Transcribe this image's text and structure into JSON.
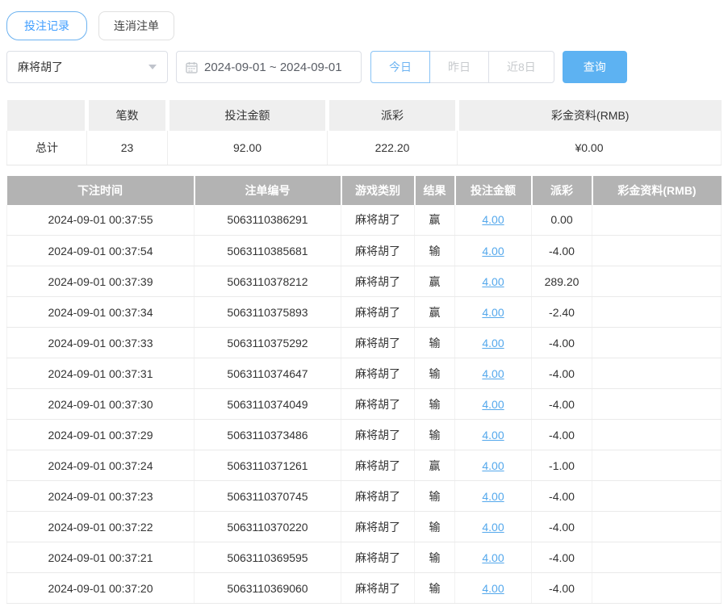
{
  "tabs": [
    {
      "label": "投注记录",
      "active": true
    },
    {
      "label": "连消注单",
      "active": false
    }
  ],
  "filters": {
    "game_selected": "麻将胡了",
    "date_range": "2024-09-01 ~ 2024-09-01",
    "quick_buttons": [
      "今日",
      "昨日",
      "近8日"
    ],
    "active_quick_button": "今日",
    "search_label": "查询"
  },
  "summary": {
    "headers": [
      "",
      "笔数",
      "投注金额",
      "派彩",
      "彩金资料(RMB)"
    ],
    "total": {
      "label": "总计",
      "count": "23",
      "bet": "92.00",
      "payout": "222.20",
      "bonus": "¥0.00"
    }
  },
  "table": {
    "headers": [
      "下注时间",
      "注单编号",
      "游戏类别",
      "结果",
      "投注金额",
      "派彩",
      "彩金资料(RMB)"
    ],
    "rows": [
      {
        "time": "2024-09-01 00:37:55",
        "order_no": "5063110386291",
        "game": "麻将胡了",
        "result": "赢",
        "bet": "4.00",
        "payout": "0.00",
        "bonus": ""
      },
      {
        "time": "2024-09-01 00:37:54",
        "order_no": "5063110385681",
        "game": "麻将胡了",
        "result": "输",
        "bet": "4.00",
        "payout": "-4.00",
        "bonus": ""
      },
      {
        "time": "2024-09-01 00:37:39",
        "order_no": "5063110378212",
        "game": "麻将胡了",
        "result": "赢",
        "bet": "4.00",
        "payout": "289.20",
        "bonus": ""
      },
      {
        "time": "2024-09-01 00:37:34",
        "order_no": "5063110375893",
        "game": "麻将胡了",
        "result": "赢",
        "bet": "4.00",
        "payout": "-2.40",
        "bonus": ""
      },
      {
        "time": "2024-09-01 00:37:33",
        "order_no": "5063110375292",
        "game": "麻将胡了",
        "result": "输",
        "bet": "4.00",
        "payout": "-4.00",
        "bonus": ""
      },
      {
        "time": "2024-09-01 00:37:31",
        "order_no": "5063110374647",
        "game": "麻将胡了",
        "result": "输",
        "bet": "4.00",
        "payout": "-4.00",
        "bonus": ""
      },
      {
        "time": "2024-09-01 00:37:30",
        "order_no": "5063110374049",
        "game": "麻将胡了",
        "result": "输",
        "bet": "4.00",
        "payout": "-4.00",
        "bonus": ""
      },
      {
        "time": "2024-09-01 00:37:29",
        "order_no": "5063110373486",
        "game": "麻将胡了",
        "result": "输",
        "bet": "4.00",
        "payout": "-4.00",
        "bonus": ""
      },
      {
        "time": "2024-09-01 00:37:24",
        "order_no": "5063110371261",
        "game": "麻将胡了",
        "result": "赢",
        "bet": "4.00",
        "payout": "-1.00",
        "bonus": ""
      },
      {
        "time": "2024-09-01 00:37:23",
        "order_no": "5063110370745",
        "game": "麻将胡了",
        "result": "输",
        "bet": "4.00",
        "payout": "-4.00",
        "bonus": ""
      },
      {
        "time": "2024-09-01 00:37:22",
        "order_no": "5063110370220",
        "game": "麻将胡了",
        "result": "输",
        "bet": "4.00",
        "payout": "-4.00",
        "bonus": ""
      },
      {
        "time": "2024-09-01 00:37:21",
        "order_no": "5063110369595",
        "game": "麻将胡了",
        "result": "输",
        "bet": "4.00",
        "payout": "-4.00",
        "bonus": ""
      },
      {
        "time": "2024-09-01 00:37:20",
        "order_no": "5063110369060",
        "game": "麻将胡了",
        "result": "输",
        "bet": "4.00",
        "payout": "-4.00",
        "bonus": ""
      }
    ]
  },
  "colors": {
    "accent_blue": "#409eff",
    "button_blue": "#5db2f2",
    "link_blue": "#54a8ec",
    "negative_red": "#f45b5b",
    "table_header_gray": "#b3b3b3",
    "summary_header_gray": "#efefef"
  }
}
